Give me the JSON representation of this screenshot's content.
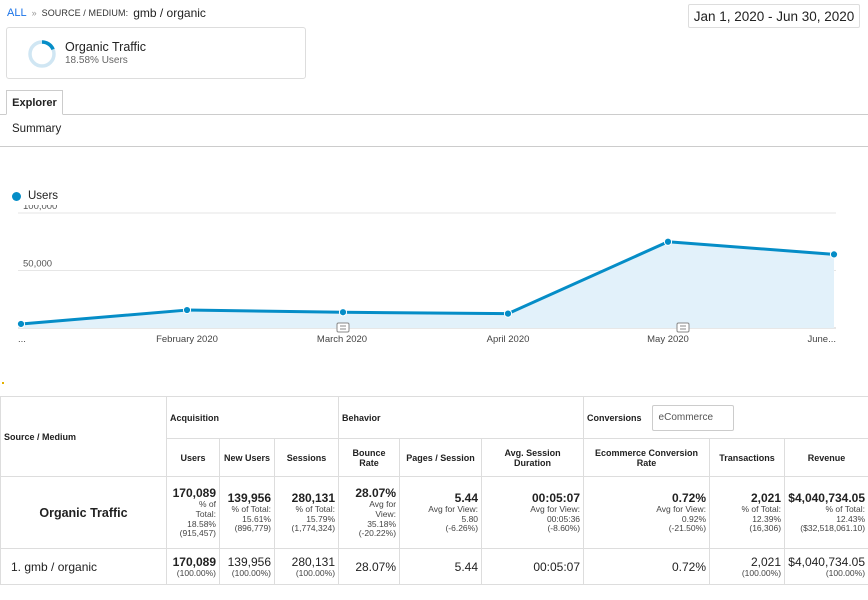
{
  "breadcrumb": {
    "all": "ALL",
    "sep": "»",
    "dimension": "SOURCE / MEDIUM:",
    "value": "gmb / organic"
  },
  "date_range": "Jan 1, 2020 - Jun 30, 2020",
  "segment": {
    "name": "Organic Traffic",
    "pct_text": "18.58% Users",
    "pct_value": 18.58
  },
  "tabs": {
    "explorer": "Explorer",
    "summary": "Summary"
  },
  "colors": {
    "series": "#058dc7",
    "fill": "#e2f1fa",
    "ring_bg": "#d0e6f3"
  },
  "chart_data": {
    "type": "line",
    "series": [
      {
        "name": "Users",
        "values": [
          3500,
          15600,
          13700,
          12500,
          75000,
          64000
        ]
      }
    ],
    "ytick_labels": [
      "50,000",
      "100,000"
    ],
    "yticks": [
      50000,
      100000
    ],
    "ylim": [
      0,
      100000
    ],
    "xtick_labels": [
      "...",
      "February 2020",
      "March 2020",
      "April 2020",
      "May 2020",
      "June..."
    ],
    "grid": true
  },
  "table": {
    "dim_header": "Source / Medium",
    "groups": {
      "acquisition": "Acquisition",
      "behavior": "Behavior",
      "conversions": "Conversions",
      "conv_select": "eCommerce"
    },
    "cols": [
      "Users",
      "New Users",
      "Sessions",
      "Bounce Rate",
      "Pages / Session",
      "Avg. Session Duration",
      "Ecommerce Conversion Rate",
      "Transactions",
      "Revenue"
    ],
    "total": {
      "label": "Organic Traffic",
      "users": {
        "v": "170,089",
        "l1": "% of",
        "l2": "Total:",
        "l3": "18.58%",
        "l4": "(915,457)"
      },
      "new_users": {
        "v": "139,956",
        "l1": "% of Total:",
        "l2": "15.61%",
        "l3": "(896,779)"
      },
      "sessions": {
        "v": "280,131",
        "l1": "% of Total:",
        "l2": "15.79%",
        "l3": "(1,774,324)"
      },
      "bounce": {
        "v": "28.07%",
        "l1": "Avg for",
        "l2": "View:",
        "l3": "35.18%",
        "l4": "(-20.22%)"
      },
      "pages": {
        "v": "5.44",
        "l1": "Avg for View:",
        "l2": "5.80",
        "l3": "(-6.26%)"
      },
      "duration": {
        "v": "00:05:07",
        "l1": "Avg for View:",
        "l2": "00:05:36",
        "l3": "(-8.60%)"
      },
      "conv": {
        "v": "0.72%",
        "l1": "Avg for View:",
        "l2": "0.92%",
        "l3": "(-21.50%)"
      },
      "trans": {
        "v": "2,021",
        "l1": "% of Total:",
        "l2": "12.39%",
        "l3": "(16,306)"
      },
      "revenue": {
        "v": "$4,040,734.05",
        "l1": "% of Total:",
        "l2": "12.43%",
        "l3": "($32,518,061.10)"
      }
    },
    "row": {
      "label": "1.  gmb / organic",
      "users": "170,089",
      "users_pct": "(100.00%)",
      "new_users": "139,956",
      "new_users_pct": "(100.00%)",
      "sessions": "280,131",
      "sessions_pct": "(100.00%)",
      "bounce": "28.07%",
      "pages": "5.44",
      "duration": "00:05:07",
      "conv": "0.72%",
      "trans": "2,021",
      "trans_pct": "(100.00%)",
      "revenue": "$4,040,734.05",
      "revenue_pct": "(100.00%)"
    }
  }
}
